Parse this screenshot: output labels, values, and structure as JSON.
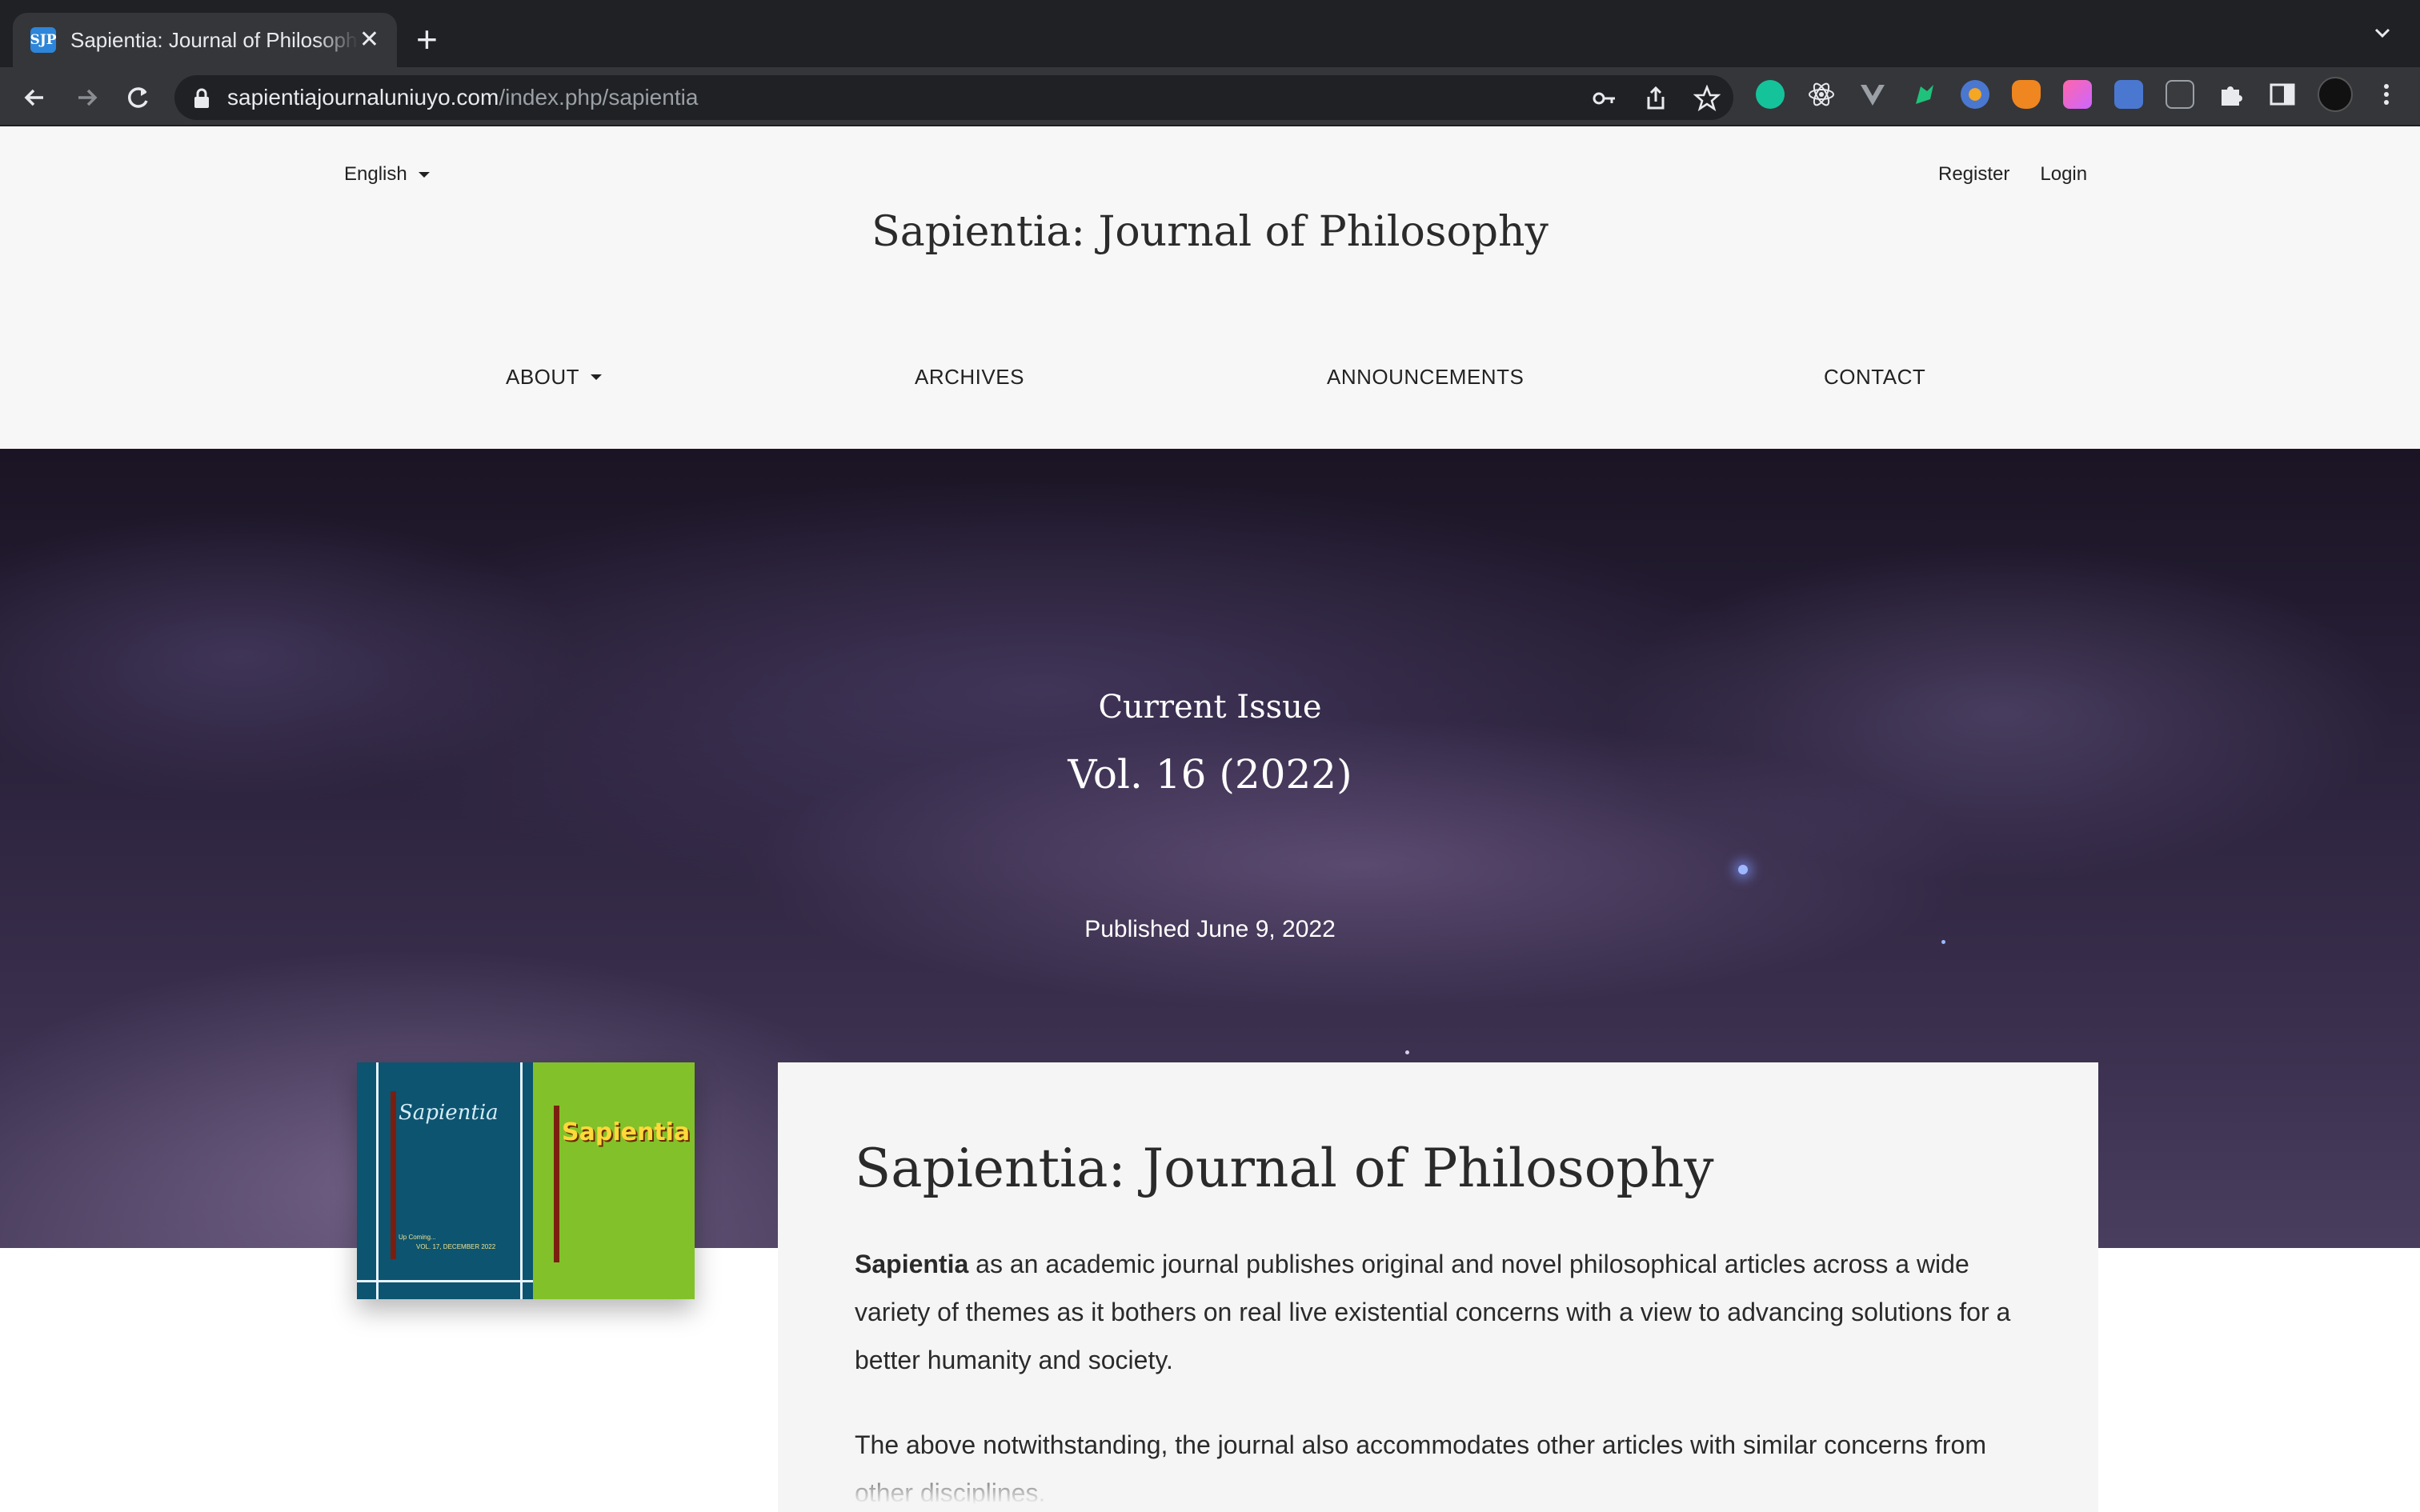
{
  "browser": {
    "tab_title": "Sapientia: Journal of Philosophy",
    "tab_favicon_text": "SJP",
    "tab_close": "✕",
    "new_tab": "+",
    "url_host": "sapientiajournaluniuyo.com",
    "url_path": "/index.php/sapientia",
    "extensions": [
      "grammarly-icon",
      "react-devtools-icon",
      "vue-devtools-icon",
      "extension-icon",
      "extension-icon",
      "metamask-icon",
      "color-picker-icon",
      "translate-icon",
      "extension-icon",
      "extensions-puzzle-icon",
      "side-panel-icon",
      "profile-avatar"
    ]
  },
  "header": {
    "language": "English",
    "register": "Register",
    "login": "Login",
    "site_title": "Sapientia: Journal of Philosophy"
  },
  "nav": {
    "about": "ABOUT",
    "archives": "ARCHIVES",
    "announcements": "ANNOUNCEMENTS",
    "contact": "CONTACT"
  },
  "hero": {
    "label": "Current Issue",
    "volume": "Vol. 16 (2022)",
    "published": "Published June 9, 2022"
  },
  "cover": {
    "title_left": "Sapientia",
    "title_right": "Sapientia",
    "note_left": "VOL. 17, DECEMBER 2022",
    "note_up": "Up Coming..."
  },
  "main": {
    "title": "Sapientia: Journal of Philosophy",
    "intro_bold": "Sapientia",
    "intro_rest": " as an academic journal publishes original and novel philosophical articles across a wide variety of themes as it bothers on real live existential concerns with a view to advancing solutions for a better humanity and society.",
    "para2": "The above notwithstanding, the journal also accommodates other articles with similar concerns from other disciplines."
  },
  "colors": {
    "chrome_dark": "#202124",
    "chrome_toolbar": "#35363a",
    "header_bg": "#f7f7f7",
    "hero_dark": "#2e2540",
    "card_bg": "#f5f5f5",
    "cover_blue": "#0c5470",
    "cover_green": "#82c12a"
  }
}
